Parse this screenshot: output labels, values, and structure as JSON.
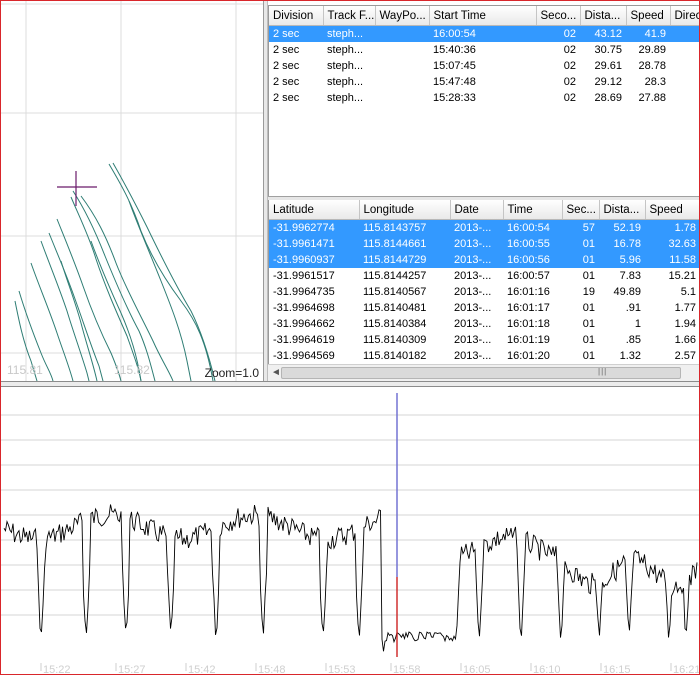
{
  "map": {
    "x_ticks": [
      "115.81",
      "115.82"
    ],
    "zoom_label": "Zoom=1.0",
    "track_color": "#2e7d74",
    "cursor_color": "#6a1b6a"
  },
  "sessions": {
    "columns": [
      "Division",
      "Track F...",
      "WayPo...",
      "Start Time",
      "Seco...",
      "Dista...",
      "Speed",
      "Direc"
    ],
    "rows": [
      {
        "division": "2 sec",
        "track": "steph...",
        "waypoint": "",
        "start": "16:00:54",
        "seconds": "02",
        "distance": "43.12",
        "speed": "41.9",
        "direction": "",
        "selected": true
      },
      {
        "division": "2 sec",
        "track": "steph...",
        "waypoint": "",
        "start": "15:40:36",
        "seconds": "02",
        "distance": "30.75",
        "speed": "29.89",
        "direction": "",
        "selected": false
      },
      {
        "division": "2 sec",
        "track": "steph...",
        "waypoint": "",
        "start": "15:07:45",
        "seconds": "02",
        "distance": "29.61",
        "speed": "28.78",
        "direction": "",
        "selected": false
      },
      {
        "division": "2 sec",
        "track": "steph...",
        "waypoint": "",
        "start": "15:47:48",
        "seconds": "02",
        "distance": "29.12",
        "speed": "28.3",
        "direction": "",
        "selected": false
      },
      {
        "division": "2 sec",
        "track": "steph...",
        "waypoint": "",
        "start": "15:28:33",
        "seconds": "02",
        "distance": "28.69",
        "speed": "27.88",
        "direction": "",
        "selected": false
      }
    ]
  },
  "points": {
    "columns": [
      "Latitude",
      "Longitude",
      "Date",
      "Time",
      "Sec...",
      "Dista...",
      "Speed"
    ],
    "rows": [
      {
        "lat": "-31.9962774",
        "lon": "115.8143757",
        "date": "2013-...",
        "time": "16:00:54",
        "sec": "57",
        "dist": "52.19",
        "speed": "1.78",
        "selected": true
      },
      {
        "lat": "-31.9961471",
        "lon": "115.8144661",
        "date": "2013-...",
        "time": "16:00:55",
        "sec": "01",
        "dist": "16.78",
        "speed": "32.63",
        "selected": true
      },
      {
        "lat": "-31.9960937",
        "lon": "115.8144729",
        "date": "2013-...",
        "time": "16:00:56",
        "sec": "01",
        "dist": "5.96",
        "speed": "11.58",
        "selected": true
      },
      {
        "lat": "-31.9961517",
        "lon": "115.8144257",
        "date": "2013-...",
        "time": "16:00:57",
        "sec": "01",
        "dist": "7.83",
        "speed": "15.21",
        "selected": false
      },
      {
        "lat": "-31.9964735",
        "lon": "115.8140567",
        "date": "2013-...",
        "time": "16:01:16",
        "sec": "19",
        "dist": "49.89",
        "speed": "5.1",
        "selected": false
      },
      {
        "lat": "-31.9964698",
        "lon": "115.8140481",
        "date": "2013-...",
        "time": "16:01:17",
        "sec": "01",
        "dist": ".91",
        "speed": "1.77",
        "selected": false
      },
      {
        "lat": "-31.9964662",
        "lon": "115.8140384",
        "date": "2013-...",
        "time": "16:01:18",
        "sec": "01",
        "dist": "1",
        "speed": "1.94",
        "selected": false
      },
      {
        "lat": "-31.9964619",
        "lon": "115.8140309",
        "date": "2013-...",
        "time": "16:01:19",
        "sec": "01",
        "dist": ".85",
        "speed": "1.66",
        "selected": false
      },
      {
        "lat": "-31.9964569",
        "lon": "115.8140182",
        "date": "2013-...",
        "time": "16:01:20",
        "sec": "01",
        "dist": "1.32",
        "speed": "2.57",
        "selected": false
      }
    ]
  },
  "scrollbar": {
    "left_arrow": "◄",
    "grip": "|||"
  },
  "profile": {
    "x_ticks": [
      "15:22",
      "15:27",
      "15:42",
      "15:48",
      "15:53",
      "15:58",
      "16:05",
      "16:10",
      "16:15",
      "16:21"
    ],
    "cursor_color": "#6a6ad0",
    "cursor_bottom_color": "#cc2222",
    "line_color": "#000000",
    "grid_color": "#d6d6d6"
  }
}
